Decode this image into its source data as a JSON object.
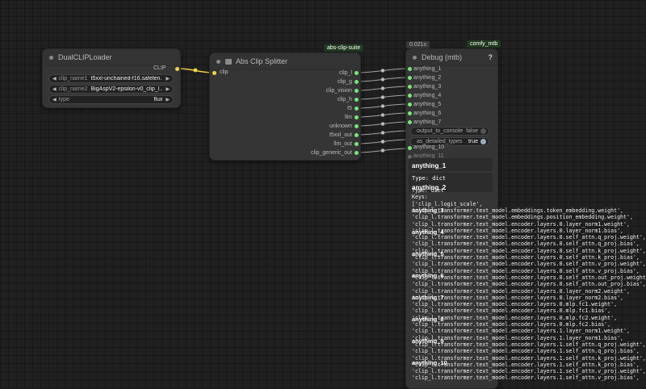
{
  "canvas": {
    "links_color": "#f2d04a",
    "slot_color_clip": "#f2d04a",
    "slot_color_any": "#79e579"
  },
  "dual_clip_loader": {
    "title": "DualCLIPLoader",
    "output_label": "CLIP",
    "widgets": [
      {
        "label": "clip_name1",
        "value": "t5xxl-unchained-f16.safeten..."
      },
      {
        "label": "clip_name2",
        "value": "BigAspV2-epsilon-v0_clip_l..."
      },
      {
        "label": "type",
        "value": "flux"
      }
    ]
  },
  "abs_clip_splitter": {
    "badge": "abs-clip-suite",
    "title": "Abs Clip Splitter",
    "input_label": "clip",
    "outputs": [
      "clip_l",
      "clip_g",
      "clip_vision",
      "clip_h",
      "t5",
      "llm",
      "unknown",
      "t5xxl_out",
      "llm_out",
      "clip_generic_out"
    ]
  },
  "debug_node": {
    "badge": "comfy_mtb",
    "timing": "0.021s",
    "title": "Debug (mtb)",
    "help": "?",
    "inputs": [
      "anything_1",
      "anything_2",
      "anything_3",
      "anything_4",
      "anything_5",
      "anything_6",
      "anything_7"
    ],
    "toggles": [
      {
        "label": "output_to_console",
        "value": "false"
      },
      {
        "label": "as_detailed_types",
        "value": "true"
      }
    ],
    "extra_inputs": [
      "anything_10",
      "anything_11"
    ],
    "preview_heading": "anything_1",
    "preview_type": "Type: dict",
    "preview_heading_2": "anything_2"
  },
  "debug_output": [
    "Type: dict",
    "Keys:",
    "['clip_l.logit_scale',",
    "'clip_l.transformer.text_model.embeddings.token_embedding.weight',",
    "'clip_l.transformer.text_model.embeddings.position_embedding.weight',",
    "'clip_l.transformer.text_model.encoder.layers.0.layer_norm1.weight',",
    "'clip_l.transformer.text_model.encoder.layers.0.layer_norm1.bias',",
    "'clip_l.transformer.text_model.encoder.layers.0.self_attn.q_proj.weight',",
    "'clip_l.transformer.text_model.encoder.layers.0.self_attn.q_proj.bias',",
    "'clip_l.transformer.text_model.encoder.layers.0.self_attn.k_proj.weight',",
    "'clip_l.transformer.text_model.encoder.layers.0.self_attn.k_proj.bias',",
    "'clip_l.transformer.text_model.encoder.layers.0.self_attn.v_proj.weight',",
    "'clip_l.transformer.text_model.encoder.layers.0.self_attn.v_proj.bias',",
    "'clip_l.transformer.text_model.encoder.layers.0.self_attn.out_proj.weight',",
    "'clip_l.transformer.text_model.encoder.layers.0.self_attn.out_proj.bias',",
    "'clip_l.transformer.text_model.encoder.layers.0.layer_norm2.weight',",
    "'clip_l.transformer.text_model.encoder.layers.0.layer_norm2.bias',",
    "'clip_l.transformer.text_model.encoder.layers.0.mlp.fc1.weight',",
    "'clip_l.transformer.text_model.encoder.layers.0.mlp.fc1.bias',",
    "'clip_l.transformer.text_model.encoder.layers.0.mlp.fc2.weight',",
    "'clip_l.transformer.text_model.encoder.layers.0.mlp.fc2.bias',",
    "'clip_l.transformer.text_model.encoder.layers.1.layer_norm1.weight',",
    "'clip_l.transformer.text_model.encoder.layers.1.layer_norm1.bias',",
    "'clip_l.transformer.text_model.encoder.layers.1.self_attn.q_proj.weight',",
    "'clip_l.transformer.text_model.encoder.layers.1.self_attn.q_proj.bias',",
    "'clip_l.transformer.text_model.encoder.layers.1.self_attn.k_proj.weight',",
    "'clip_l.transformer.text_model.encoder.layers.1.self_attn.k_proj.bias',",
    "'clip_l.transformer.text_model.encoder.layers.1.self_attn.v_proj.weight',",
    "'clip_l.transformer.text_model.encoder.layers.1.self_attn.v_proj.bias',"
  ],
  "overlap_labels": [
    "anything_3",
    "anything_4",
    "anything_5",
    "anything_6",
    "anything_7",
    "anything_8",
    "anything_9",
    "anything_10"
  ]
}
